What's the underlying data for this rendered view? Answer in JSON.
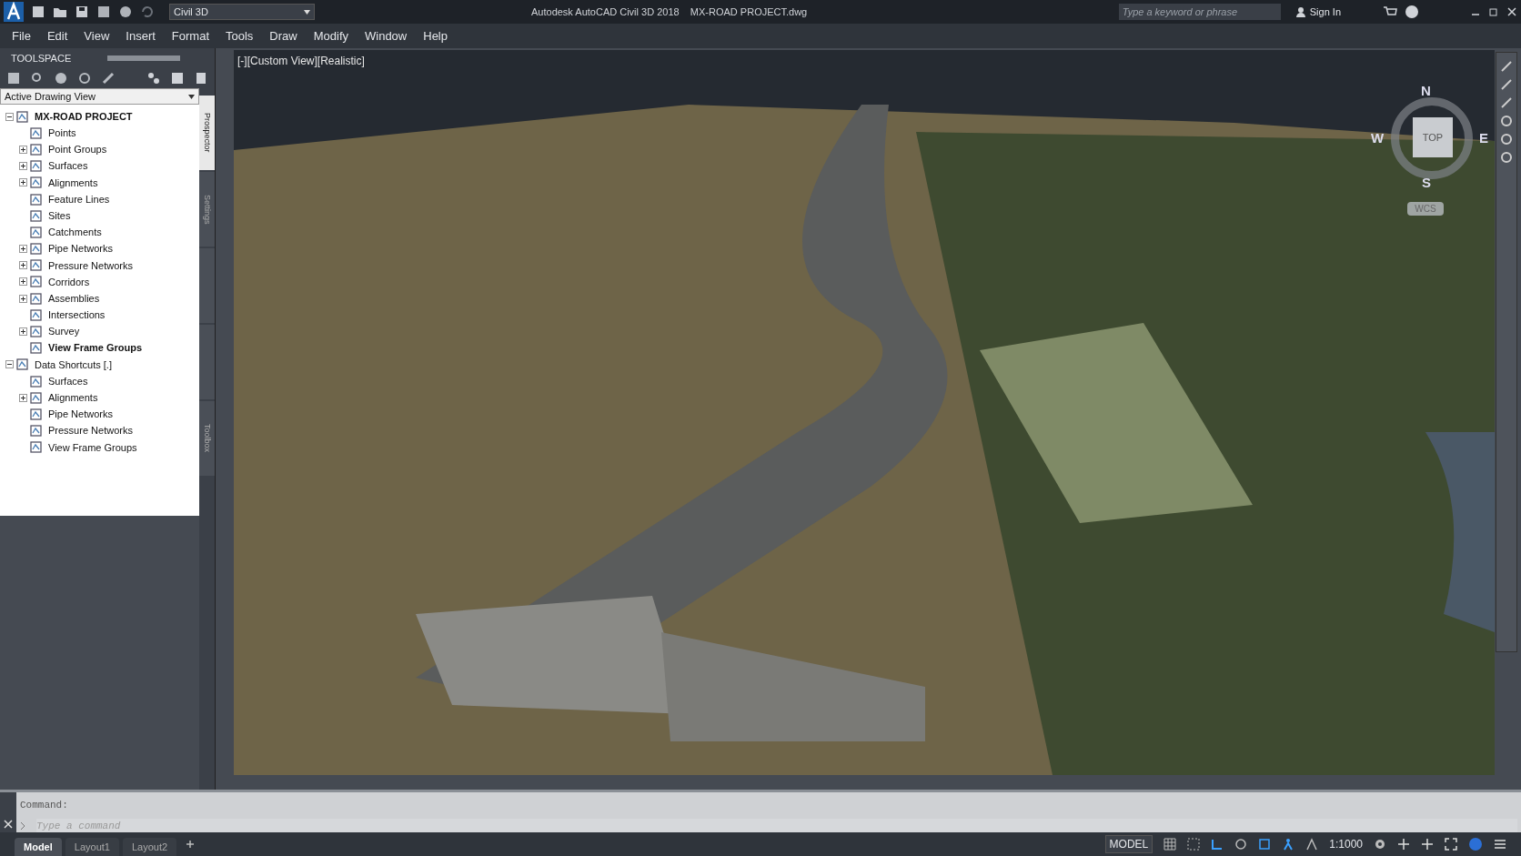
{
  "title_bar": {
    "workspace": "Civil 3D",
    "title": "Autodesk AutoCAD Civil 3D 2018",
    "file": "MX-ROAD PROJECT.dwg",
    "search": {
      "placeholder": "Type a keyword or phrase"
    },
    "sign_in": "Sign In"
  },
  "menu": [
    "File",
    "Edit",
    "View",
    "Insert",
    "Format",
    "Tools",
    "Draw",
    "Modify",
    "Window",
    "Help"
  ],
  "toolspace": {
    "title": "TOOLSPACE",
    "view_dropdown": "Active Drawing View",
    "side_tabs": [
      {
        "label": "Prospector",
        "selected": true
      },
      {
        "label": "Settings",
        "selected": false
      },
      {
        "selected": false
      },
      {
        "selected": false
      },
      {
        "label": "Toolbox",
        "selected": false
      }
    ],
    "tree": [
      {
        "label": "MX-ROAD PROJECT",
        "emphasized": true,
        "expanded": true,
        "children": [
          {
            "label": "Points",
            "emphasized": false
          },
          {
            "label": "Point Groups",
            "emphasized": false,
            "expanded": false
          },
          {
            "label": "Surfaces",
            "emphasized": false,
            "expanded": false
          },
          {
            "label": "Alignments",
            "emphasized": false,
            "expanded": false
          },
          {
            "label": "Feature Lines",
            "emphasized": false
          },
          {
            "label": "Sites",
            "emphasized": false
          },
          {
            "label": "Catchments",
            "emphasized": false
          },
          {
            "label": "Pipe Networks",
            "emphasized": false,
            "expanded": false
          },
          {
            "label": "Pressure Networks",
            "emphasized": false,
            "expanded": false
          },
          {
            "label": "Corridors",
            "emphasized": false,
            "expanded": false
          },
          {
            "label": "Assemblies",
            "emphasized": false,
            "expanded": false
          },
          {
            "label": "Intersections",
            "emphasized": false
          },
          {
            "label": "Survey",
            "emphasized": false,
            "expanded": false
          },
          {
            "label": "View Frame Groups",
            "emphasized": true
          }
        ]
      },
      {
        "label": "Data Shortcuts [.]",
        "emphasized": false,
        "expanded": true,
        "children": [
          {
            "label": "Surfaces",
            "emphasized": false
          },
          {
            "label": "Alignments",
            "emphasized": false,
            "expanded": false
          },
          {
            "label": "Pipe Networks",
            "emphasized": false
          },
          {
            "label": "Pressure Networks",
            "emphasized": false
          },
          {
            "label": "View Frame Groups",
            "emphasized": false
          }
        ]
      }
    ]
  },
  "viewport": {
    "label": "[-][Custom View][Realistic]",
    "viewcube": {
      "north": "N",
      "east": "E",
      "south": "S",
      "west": "W",
      "face": "TOP",
      "ucs": "WCS"
    }
  },
  "command_line": {
    "history": "Command:",
    "placeholder": "Type a command"
  },
  "layout_tabs": [
    {
      "label": "Model",
      "selected": true
    },
    {
      "label": "Layout1",
      "selected": false
    },
    {
      "label": "Layout2",
      "selected": false
    }
  ],
  "status_bar": {
    "space": "MODEL",
    "scale": "1:1000"
  }
}
